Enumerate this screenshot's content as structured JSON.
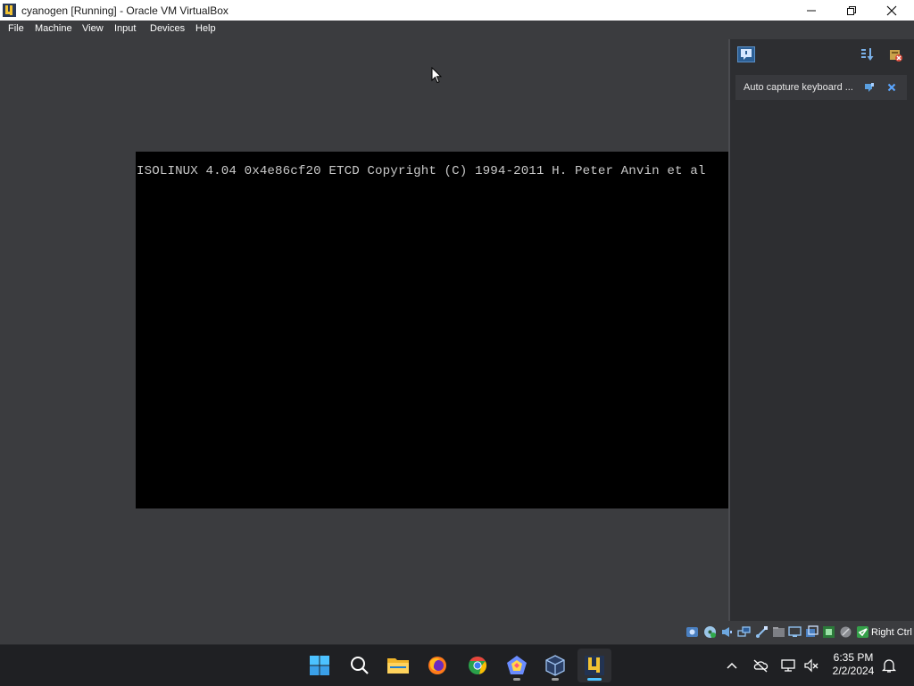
{
  "window": {
    "title": "cyanogen [Running] - Oracle VM VirtualBox",
    "controls": {
      "minimize": "minimize-icon",
      "maximize": "restore-icon",
      "close": "close-icon"
    }
  },
  "menu": {
    "items": [
      "File",
      "Machine",
      "View",
      "Input",
      "Devices",
      "Help"
    ]
  },
  "vm_screen": {
    "text": "ISOLINUX 4.04 0x4e86cf20 ETCD Copyright (C) 1994-2011 H. Peter Anvin et al"
  },
  "notification_center": {
    "main_icon": "notification-center-icon",
    "header_icons": [
      "sort-icon",
      "delete-all-icon"
    ],
    "items": [
      {
        "text": "Auto capture keyboard ...",
        "icons": [
          "pin-icon",
          "close-icon"
        ]
      }
    ]
  },
  "status_bar": {
    "icons": [
      "hard-disk-icon",
      "optical-drive-icon",
      "audio-icon",
      "network-icon",
      "usb-icon",
      "shared-folders-icon",
      "display-icon",
      "recording-icon",
      "vt-x-icon",
      "mouse-integration-icon",
      "keyboard-capture-icon"
    ],
    "host_key": "Right Ctrl"
  },
  "taskbar": {
    "apps": [
      {
        "name": "start",
        "icon": "windows-start-icon"
      },
      {
        "name": "search",
        "icon": "search-icon"
      },
      {
        "name": "file-explorer",
        "icon": "folder-icon"
      },
      {
        "name": "firefox",
        "icon": "firefox-icon"
      },
      {
        "name": "chrome",
        "icon": "chrome-icon"
      },
      {
        "name": "pentagon-app",
        "icon": "pentagon-app-icon"
      },
      {
        "name": "virtualbox-manager",
        "icon": "virtualbox-manager-icon"
      },
      {
        "name": "virtualbox-vm",
        "icon": "virtualbox-vm-icon"
      }
    ],
    "tray_icons": [
      "chevron-up-icon",
      "cloud-off-icon",
      "network-icon",
      "volume-muted-icon"
    ],
    "clock": {
      "time": "6:35 PM",
      "date": "2/2/2024"
    },
    "notification_icon": "bell-icon"
  },
  "colors": {
    "window_bg": "#3b3c3f",
    "vm_bg": "#000000",
    "vm_text": "#c8c8c8",
    "taskbar_bg": "#1f2023",
    "accent": "#4cc2ff"
  }
}
